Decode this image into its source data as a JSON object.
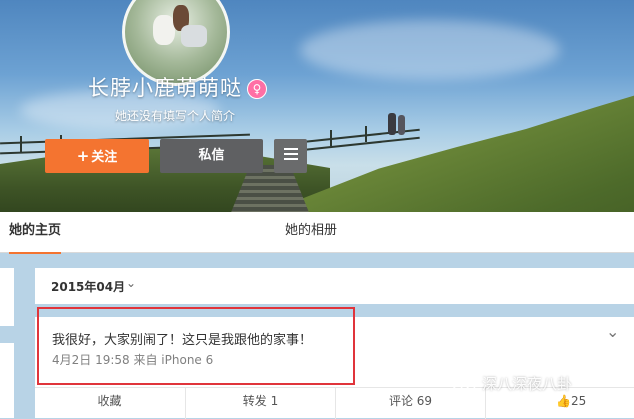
{
  "profile": {
    "name": "长脖小鹿萌萌哒",
    "gender_badge": "♀",
    "bio": "她还没有填写个人简介"
  },
  "actions_top": {
    "follow_icon": "+",
    "follow_label": "关注",
    "message_label": "私信",
    "more_icon": "hamburger-icon"
  },
  "tabs": [
    {
      "label": "她的主页",
      "active": true
    },
    {
      "label": "她的相册",
      "active": false
    }
  ],
  "timeline": {
    "date_filter": "2015年04月",
    "date_chevron": "⌄"
  },
  "post": {
    "text": "我很好，大家别闹了！这只是我跟他的家事！",
    "meta": "4月2日 19:58 来自 iPhone 6",
    "menu_chevron": "⌄",
    "actions": {
      "favorite": "收藏",
      "repost": "转发 1",
      "comment": "评论 69",
      "like_icon": "👍",
      "like_count": "25"
    }
  },
  "watermark": {
    "text": "深八深夜八卦"
  },
  "colors": {
    "accent_orange": "#f47430",
    "highlight_red": "#e0343b",
    "female_pink": "#ff6fa5"
  }
}
